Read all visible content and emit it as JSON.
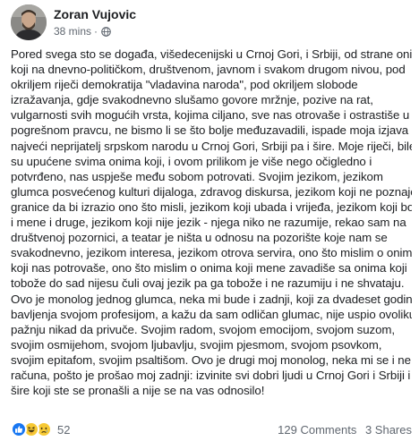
{
  "post": {
    "author": "Zoran Vujovic",
    "time": "38 mins",
    "separator": "·",
    "privacy_icon": "globe-icon",
    "lines": [
      "Pored svega sto se događa, višedecenijski u Crnoj Gori, i Srbiji, od strane onih",
      "koji na dnevno-političkom, društvenom, javnom i svakom drugom nivou, pod",
      "okriljem riječi demokratija \"vladavina naroda\", pod okriljem slobode",
      "izražavanja, gdje svakodnevno slušamo govore mržnje, pozive na rat,",
      "vulgarnosti svih mogućih vrsta, kojima ciljano, sve nas otrovaše i ostrastiše u",
      "pogrešnom pravcu, ne bismo li se što bolje međuzavadili, ispade moja izjava",
      "najveći neprijatelj srpskom narodu u Crnoj Gori, Srbiji pa i šire. Moje riječi, bile",
      "su upućene svima onima koji, i ovom prilikom je više nego očigledno i",
      "potvrđeno, nas uspješe među sobom potrovati. Svojim jezikom, jezikom",
      "glumca posvećenog kulturi dijaloga, zdravog diskursa, jezikom koji ne poznaje",
      "granice da bi izrazio ono što misli, jezikom koji ubada i vrijeđa, jezikom koji boli",
      "i mene i druge, jezikom koji nije jezik - njega niko ne razumije, rekao sam na",
      "društvenoj pozornici, a teatar je ništa u odnosu na pozorište koje nam se",
      "svakodnevno, jezikom interesa, jezikom otrova servira, ono što mislim o onima",
      "koji nas potrovaše, ono što mislim o onima koji mene zavadiše sa onima koji",
      "tobože do sad nijesu čuli ovaj jezik pa ga tobože i ne razumiju i ne shvataju.",
      "Ovo je monolog jednog glumca, neka mi bude i zadnji, koji za dvadeset godina",
      "bavljenja svojom profesijom, a kažu da sam odličan glumac, nije uspio ovoliku",
      "pažnju nikad da privuče. Svojim radom, svojom emocijom, svojom suzom,",
      "svojim osmijehom, svojom ljubavlju, svojim pjesmom, svojom psovkom,",
      "svojim epitafom, svojim psaltišom. Ovo je drugi moj monolog, neka mi se i ne",
      "računa, pošto je prošao moj zadnji: izvinite svi dobri ljudi u Crnoj Gori i Srbiji i",
      "šire koji ste se pronašli a nije se na vas odnosilo!"
    ]
  },
  "footer": {
    "reaction_icons": [
      "like-icon",
      "haha-icon",
      "sad-icon"
    ],
    "reaction_count": "52",
    "comments": "129 Comments",
    "shares": "3 Shares"
  },
  "colors": {
    "like": "#1877f2",
    "emoji": "#f7c934",
    "meta": "#606770",
    "text": "#1c1e21"
  }
}
